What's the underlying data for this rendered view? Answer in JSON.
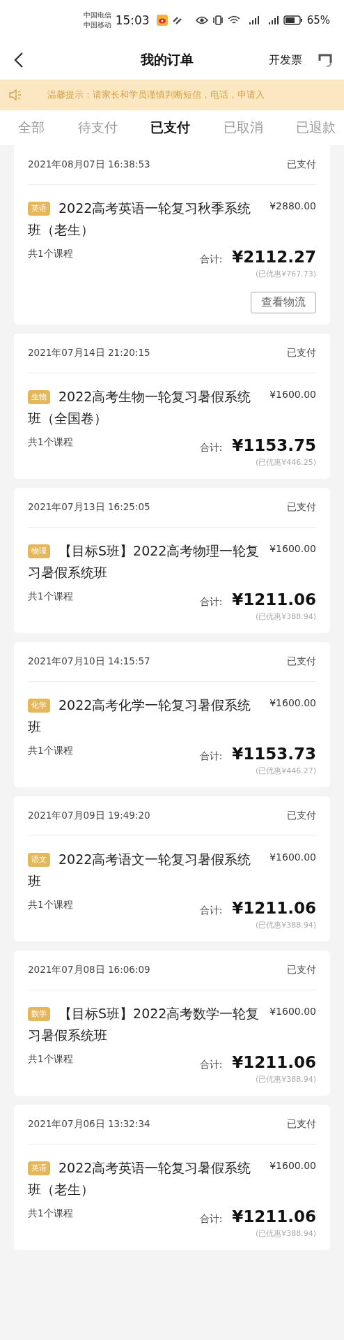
{
  "status_bar": {
    "carriers": [
      "中国电信",
      "中国移动"
    ],
    "time": "15:03",
    "battery": "65%"
  },
  "header": {
    "title": "我的订单",
    "action": "开发票"
  },
  "notice": {
    "text": "温馨提示：请家长和学员谨慎判断短信，电话，申请入"
  },
  "tabs": [
    {
      "label": "全部",
      "selected": false
    },
    {
      "label": "待支付",
      "selected": false
    },
    {
      "label": "已支付",
      "selected": true
    },
    {
      "label": "已取消",
      "selected": false
    },
    {
      "label": "已退款",
      "selected": false
    }
  ],
  "orders": [
    {
      "time": "2021年08月07日 16:38:53",
      "status": "已支付",
      "tag": "英语",
      "title": "2022高考英语一轮复习秋季系统班（老生）",
      "price": "¥2880.00",
      "count": "共1个课程",
      "total_label": "合计:",
      "total": "¥2112.27",
      "discount": "(已优惠¥767.73)",
      "button": "查看物流"
    },
    {
      "time": "2021年07月14日 21:20:15",
      "status": "已支付",
      "tag": "生物",
      "title": "2022高考生物一轮复习暑假系统班（全国卷）",
      "price": "¥1600.00",
      "count": "共1个课程",
      "total_label": "合计:",
      "total": "¥1153.75",
      "discount": "(已优惠¥446.25)"
    },
    {
      "time": "2021年07月13日 16:25:05",
      "status": "已支付",
      "tag": "物理",
      "title": "【目标S班】2022高考物理一轮复习暑假系统班",
      "price": "¥1600.00",
      "count": "共1个课程",
      "total_label": "合计:",
      "total": "¥1211.06",
      "discount": "(已优惠¥388.94)"
    },
    {
      "time": "2021年07月10日 14:15:57",
      "status": "已支付",
      "tag": "化学",
      "title": "2022高考化学一轮复习暑假系统班",
      "price": "¥1600.00",
      "count": "共1个课程",
      "total_label": "合计:",
      "total": "¥1153.73",
      "discount": "(已优惠¥446.27)"
    },
    {
      "time": "2021年07月09日 19:49:20",
      "status": "已支付",
      "tag": "语文",
      "title": "2022高考语文一轮复习暑假系统班",
      "price": "¥1600.00",
      "count": "共1个课程",
      "total_label": "合计:",
      "total": "¥1211.06",
      "discount": "(已优惠¥388.94)"
    },
    {
      "time": "2021年07月08日 16:06:09",
      "status": "已支付",
      "tag": "数学",
      "title": "【目标S班】2022高考数学一轮复习暑假系统班",
      "price": "¥1600.00",
      "count": "共1个课程",
      "total_label": "合计:",
      "total": "¥1211.06",
      "discount": "(已优惠¥388.94)"
    },
    {
      "time": "2021年07月06日 13:32:34",
      "status": "已支付",
      "tag": "英语",
      "title": "2022高考英语一轮复习暑假系统班（老生）",
      "price": "¥1600.00",
      "count": "共1个课程",
      "total_label": "合计:",
      "total": "¥1211.06",
      "discount": "(已优惠¥388.94)"
    }
  ]
}
